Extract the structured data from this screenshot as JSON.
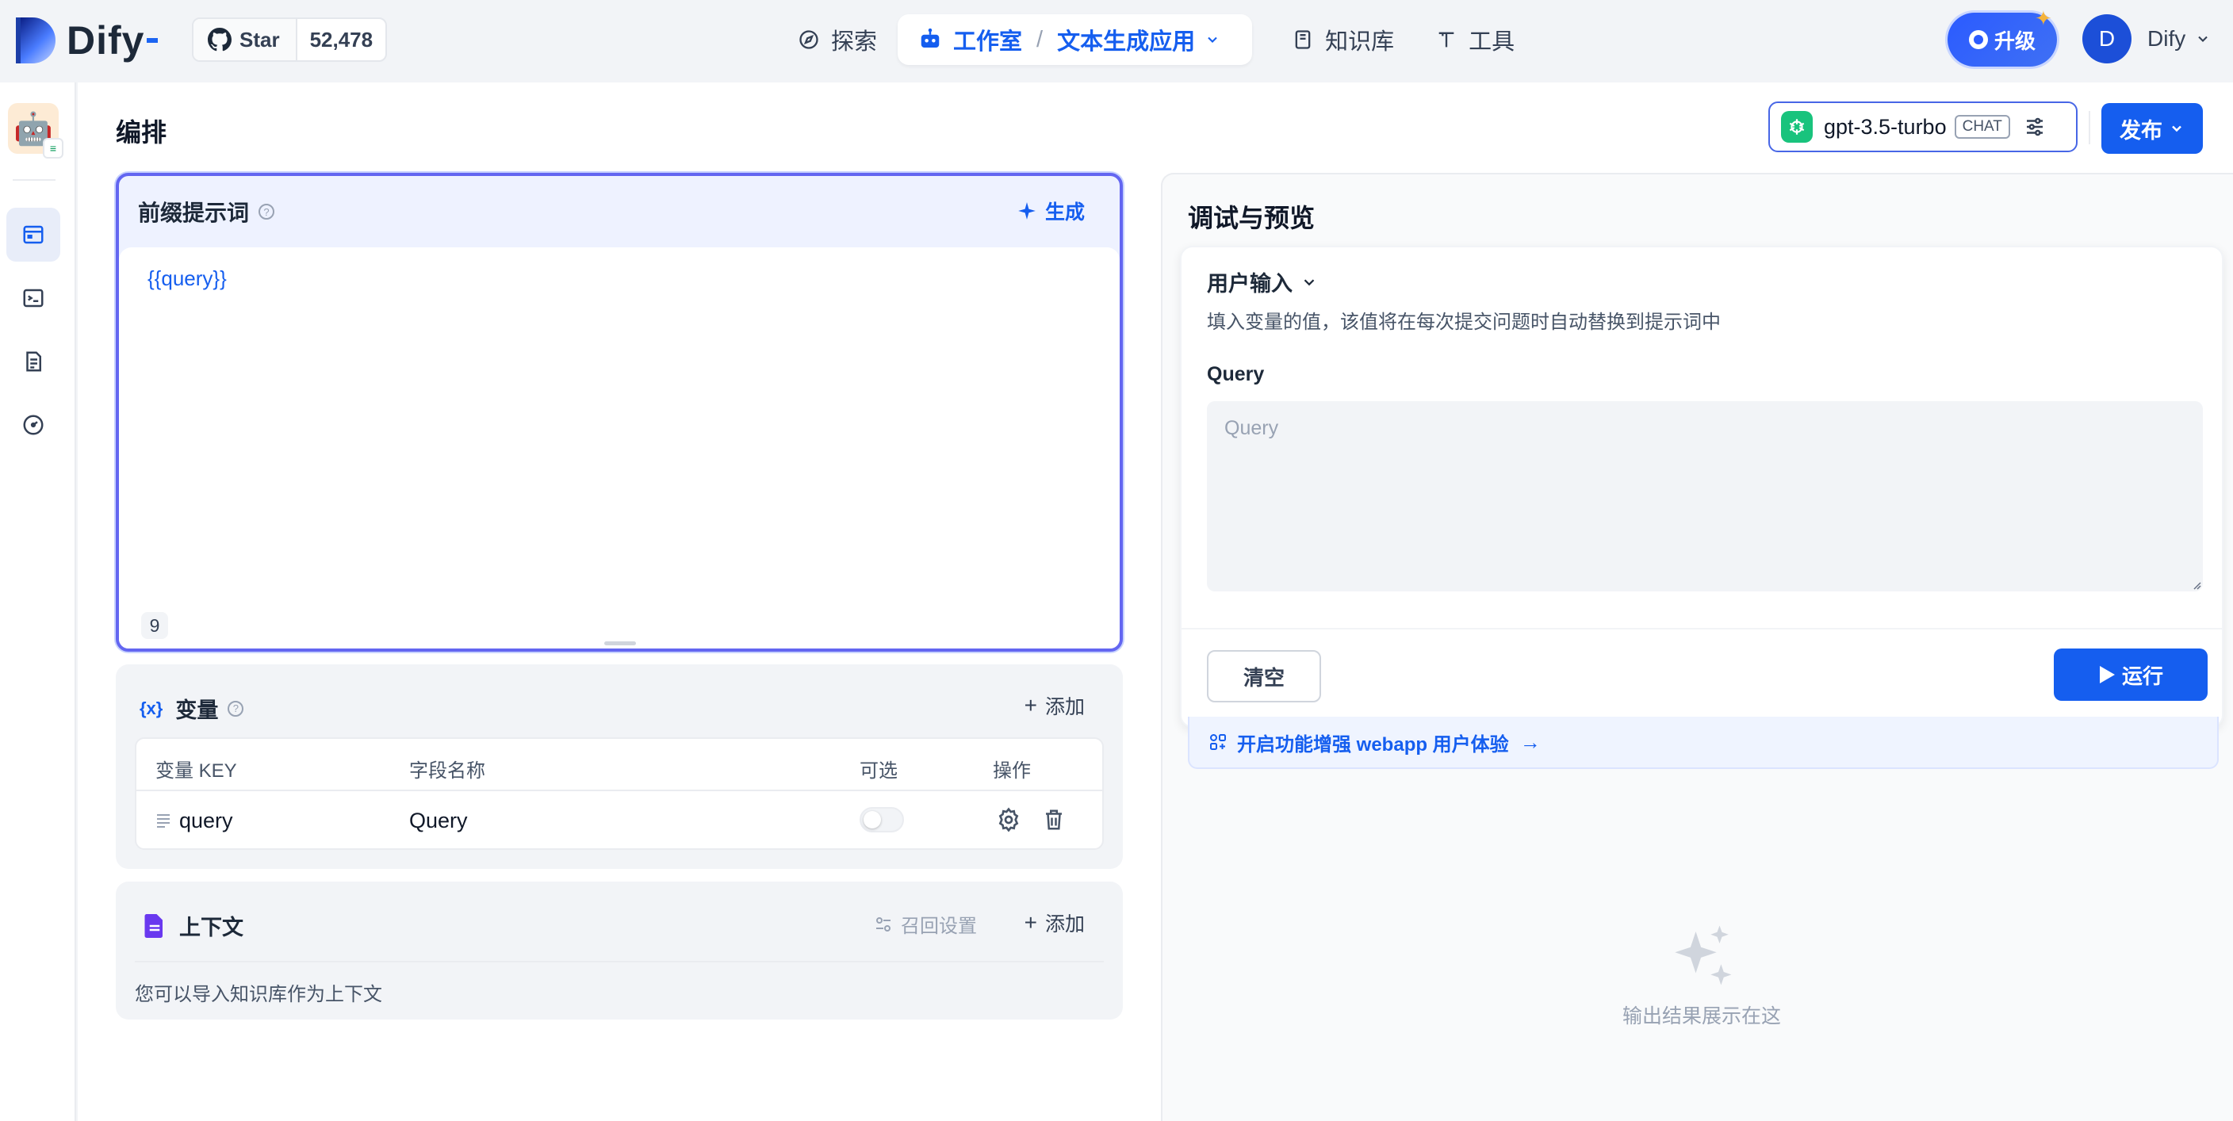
{
  "brand": {
    "name": "Dify"
  },
  "github": {
    "star_label": "Star",
    "star_count": "52,478"
  },
  "nav": {
    "explore": "探索",
    "studio": "工作室",
    "app_name": "文本生成应用",
    "knowledge": "知识库",
    "tools": "工具"
  },
  "header_right": {
    "upgrade_label": "升级",
    "user_initial": "D",
    "user_name": "Dify"
  },
  "page": {
    "title": "编排"
  },
  "model": {
    "name": "gpt-3.5-turbo",
    "mode_tag": "CHAT"
  },
  "publish_label": "发布",
  "prompt": {
    "title": "前缀提示词",
    "generate_label": "生成",
    "content": "{{query}}",
    "char_count": "9"
  },
  "variables": {
    "icon_text": "{x}",
    "title": "变量",
    "add_label": "添加",
    "columns": [
      "变量 KEY",
      "字段名称",
      "可选",
      "操作"
    ],
    "rows": [
      {
        "key": "query",
        "field_name": "Query",
        "optional": false
      }
    ]
  },
  "context": {
    "title": "上下文",
    "recall_label": "召回设置",
    "add_label": "添加",
    "description": "您可以导入知识库作为上下文"
  },
  "debug": {
    "title": "调试与预览",
    "user_input_label": "用户输入",
    "user_input_desc": "填入变量的值，该值将在每次提交问题时自动替换到提示词中",
    "query_label": "Query",
    "query_placeholder": "Query",
    "clear_label": "清空",
    "run_label": "运行",
    "enhance_text": "开启功能增强 webapp 用户体验",
    "empty_text": "输出结果展示在这"
  },
  "colors": {
    "accent": "#155eef",
    "prompt_border": "#6366f1",
    "openai_green": "#19c37d"
  }
}
